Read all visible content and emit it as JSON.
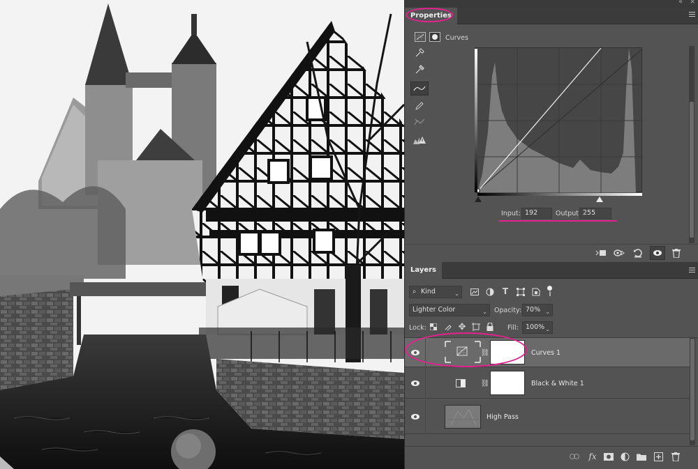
{
  "properties": {
    "tab_label": "Properties",
    "adjustment_name": "Curves",
    "input_label": "Input:",
    "input_value": "192",
    "output_label": "Output:",
    "output_value": "255"
  },
  "layers": {
    "tab_label": "Layers",
    "filter_kind": "Kind",
    "blend_mode": "Lighter Color",
    "opacity_label": "Opacity:",
    "opacity_value": "70%",
    "lock_label": "Lock:",
    "fill_label": "Fill:",
    "fill_value": "100%",
    "items": [
      {
        "name": "Curves 1",
        "selected": true
      },
      {
        "name": "Black & White 1",
        "selected": false
      },
      {
        "name": "High Pass",
        "selected": false
      }
    ]
  },
  "colors": {
    "highlight": "#e6208d",
    "panel_bg": "#535353",
    "selected_row": "#6a6a6a"
  },
  "icons": {
    "curves_tools": [
      "sample-black-eyedropper-icon",
      "sample-gray-eyedropper-icon",
      "curve-point-icon",
      "pencil-icon",
      "smooth-icon",
      "clipping-warning-icon"
    ],
    "properties_footer": [
      "clip-to-layer-icon",
      "view-previous-icon",
      "reset-icon",
      "visibility-icon",
      "delete-icon"
    ],
    "layers_footer": [
      "link-icon",
      "fx-icon",
      "mask-icon",
      "adjustment-icon",
      "group-icon",
      "new-layer-icon",
      "trash-icon"
    ]
  }
}
